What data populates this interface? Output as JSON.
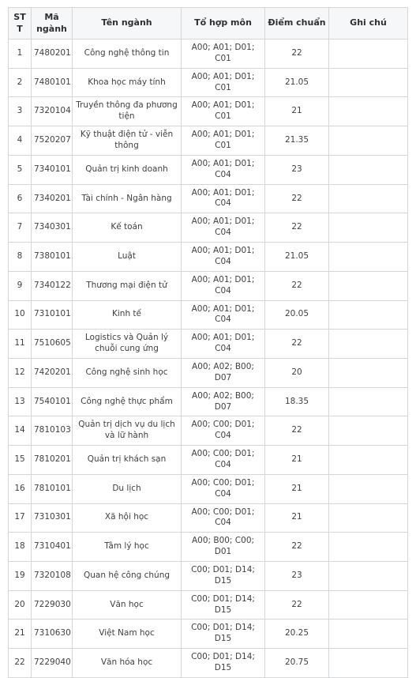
{
  "table": {
    "columns": [
      {
        "key": "stt",
        "label": "STT"
      },
      {
        "key": "ma",
        "label": "Mã ngành"
      },
      {
        "key": "ten",
        "label": "Tên ngành"
      },
      {
        "key": "to",
        "label": "Tổ hợp môn"
      },
      {
        "key": "diem",
        "label": "Điểm chuẩn"
      },
      {
        "key": "ghi",
        "label": "Ghi chú"
      }
    ],
    "rows": [
      {
        "stt": "1",
        "ma": "7480201",
        "ten": "Công nghệ thông tin",
        "to": "A00; A01; D01; C01",
        "diem": "22",
        "ghi": ""
      },
      {
        "stt": "2",
        "ma": "7480101",
        "ten": "Khoa học máy tính",
        "to": "A00; A01; D01; C01",
        "diem": "21.05",
        "ghi": ""
      },
      {
        "stt": "3",
        "ma": "7320104",
        "ten": "Truyền thông đa phương tiện",
        "to": "A00; A01; D01; C01",
        "diem": "21",
        "ghi": ""
      },
      {
        "stt": "4",
        "ma": "7520207",
        "ten": "Kỹ thuật điện tử - viễn thông",
        "to": "A00; A01; D01; C01",
        "diem": "21.35",
        "ghi": ""
      },
      {
        "stt": "5",
        "ma": "7340101",
        "ten": "Quản trị kinh doanh",
        "to": "A00; A01; D01; C04",
        "diem": "23",
        "ghi": ""
      },
      {
        "stt": "6",
        "ma": "7340201",
        "ten": "Tài chính - Ngân hàng",
        "to": "A00; A01; D01; C04",
        "diem": "22",
        "ghi": ""
      },
      {
        "stt": "7",
        "ma": "7340301",
        "ten": "Kế toán",
        "to": "A00; A01; D01; C04",
        "diem": "22",
        "ghi": ""
      },
      {
        "stt": "8",
        "ma": "7380101",
        "ten": "Luật",
        "to": "A00; A01; D01; C04",
        "diem": "21.05",
        "ghi": ""
      },
      {
        "stt": "9",
        "ma": "7340122",
        "ten": "Thương mại điện tử",
        "to": "A00; A01; D01; C04",
        "diem": "22",
        "ghi": ""
      },
      {
        "stt": "10",
        "ma": "7310101",
        "ten": "Kinh tế",
        "to": "A00; A01; D01; C04",
        "diem": "20.05",
        "ghi": ""
      },
      {
        "stt": "11",
        "ma": "7510605",
        "ten": "Logistics và Quản lý chuỗi cung ứng",
        "to": "A00; A01; D01; C04",
        "diem": "22",
        "ghi": ""
      },
      {
        "stt": "12",
        "ma": "7420201",
        "ten": "Công nghệ sinh học",
        "to": "A00; A02; B00; D07",
        "diem": "20",
        "ghi": ""
      },
      {
        "stt": "13",
        "ma": "7540101",
        "ten": "Công nghệ thực phẩm",
        "to": "A00; A02; B00; D07",
        "diem": "18.35",
        "ghi": ""
      },
      {
        "stt": "14",
        "ma": "7810103",
        "ten": "Quản trị dịch vụ du lịch và lữ hành",
        "to": "A00; C00; D01; C04",
        "diem": "22",
        "ghi": ""
      },
      {
        "stt": "15",
        "ma": "7810201",
        "ten": "Quản trị khách sạn",
        "to": "A00; C00; D01; C04",
        "diem": "21",
        "ghi": ""
      },
      {
        "stt": "16",
        "ma": "7810101",
        "ten": "Du lịch",
        "to": "A00; C00; D01; C04",
        "diem": "21",
        "ghi": ""
      },
      {
        "stt": "17",
        "ma": "7310301",
        "ten": "Xã hội học",
        "to": "A00; C00; D01; C04",
        "diem": "21",
        "ghi": ""
      },
      {
        "stt": "18",
        "ma": "7310401",
        "ten": "Tâm lý học",
        "to": "A00; B00; C00; D01",
        "diem": "22",
        "ghi": ""
      },
      {
        "stt": "19",
        "ma": "7320108",
        "ten": "Quan hệ công chúng",
        "to": "C00; D01; D14; D15",
        "diem": "23",
        "ghi": ""
      },
      {
        "stt": "20",
        "ma": "7229030",
        "ten": "Văn học",
        "to": "C00; D01; D14; D15",
        "diem": "22",
        "ghi": ""
      },
      {
        "stt": "21",
        "ma": "7310630",
        "ten": "Việt Nam học",
        "to": "C00; D01; D14; D15",
        "diem": "20.25",
        "ghi": ""
      },
      {
        "stt": "22",
        "ma": "7229040",
        "ten": "Văn hóa học",
        "to": "C00; D01; D14; D15",
        "diem": "20.75",
        "ghi": ""
      }
    ]
  },
  "style": {
    "border_color": "#d4d6d8",
    "header_background": "#f6f7f8",
    "text_color": "#3f3f3f",
    "page_background": "#ffffff"
  }
}
